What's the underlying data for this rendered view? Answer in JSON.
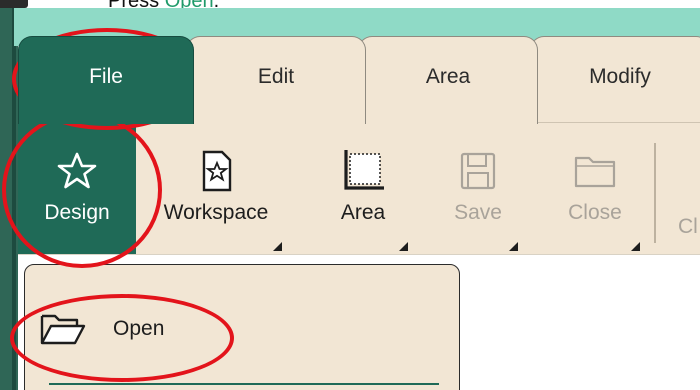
{
  "caption": {
    "prefix": "Press ",
    "highlight": "Open",
    "suffix": "."
  },
  "tabs": [
    {
      "label": "File",
      "active": true
    },
    {
      "label": "Edit",
      "active": false
    },
    {
      "label": "Area",
      "active": false
    },
    {
      "label": "Modify",
      "active": false
    }
  ],
  "ribbon": {
    "buttons": [
      {
        "label": "Design",
        "icon": "star-icon",
        "active": true,
        "enabled": true
      },
      {
        "label": "Workspace",
        "icon": "star-document-icon",
        "enabled": true
      },
      {
        "label": "Area",
        "icon": "area-frame-icon",
        "enabled": true
      },
      {
        "label": "Save",
        "icon": "floppy-disk-icon",
        "enabled": false
      },
      {
        "label": "Close",
        "icon": "folder-icon",
        "enabled": false
      }
    ],
    "cut_label": "Cl"
  },
  "menu": {
    "items": [
      {
        "label": "Open",
        "icon": "open-folder-icon"
      }
    ]
  },
  "colors": {
    "accent": "#1f6a57",
    "panel": "#f2e6d4",
    "title_band": "#8fdac6",
    "annotation": "#e3141b",
    "caption_highlight": "#1f9a6a"
  }
}
